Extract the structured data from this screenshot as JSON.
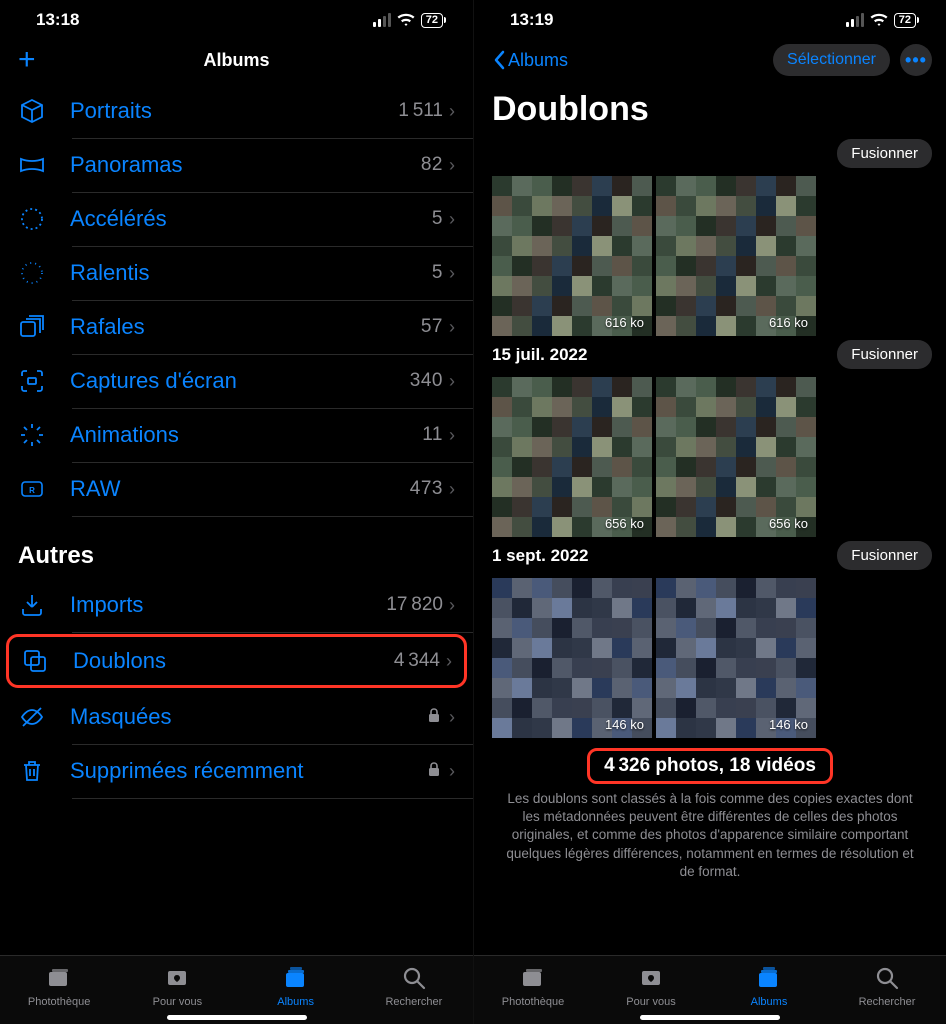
{
  "colors": {
    "accent": "#0a84ff",
    "highlight": "#ff3526",
    "secondary": "#8e8e93"
  },
  "left": {
    "status": {
      "time": "13:18",
      "battery": "72"
    },
    "nav": {
      "title": "Albums"
    },
    "rows": [
      {
        "icon": "cube",
        "label": "Portraits",
        "count": "1 511"
      },
      {
        "icon": "panorama",
        "label": "Panoramas",
        "count": "82"
      },
      {
        "icon": "timelapse",
        "label": "Accélérés",
        "count": "5"
      },
      {
        "icon": "slowmo",
        "label": "Ralentis",
        "count": "5"
      },
      {
        "icon": "burst",
        "label": "Rafales",
        "count": "57"
      },
      {
        "icon": "screenshot",
        "label": "Captures d'écran",
        "count": "340"
      },
      {
        "icon": "animations",
        "label": "Animations",
        "count": "11"
      },
      {
        "icon": "raw",
        "label": "RAW",
        "count": "473"
      }
    ],
    "section_header": "Autres",
    "other_rows": [
      {
        "icon": "import",
        "label": "Imports",
        "count": "17 820"
      },
      {
        "icon": "duplicate",
        "label": "Doublons",
        "count": "4 344",
        "highlight": true
      },
      {
        "icon": "hidden",
        "label": "Masquées",
        "locked": true
      },
      {
        "icon": "trash",
        "label": "Supprimées récemment",
        "locked": true
      }
    ]
  },
  "right": {
    "status": {
      "time": "13:19",
      "battery": "72"
    },
    "back_label": "Albums",
    "select_label": "Sélectionner",
    "page_title": "Doublons",
    "merge_label": "Fusionner",
    "groups": [
      {
        "date": "",
        "sizes": [
          "616 ko",
          "616 ko"
        ],
        "palette": "a"
      },
      {
        "date": "15 juil. 2022",
        "sizes": [
          "656 ko",
          "656 ko"
        ],
        "palette": "a"
      },
      {
        "date": "1 sept. 2022",
        "sizes": [
          "146 ko",
          "146 ko"
        ],
        "palette": "b"
      }
    ],
    "summary_count": "4 326 photos, 18 vidéos",
    "summary_text": "Les doublons sont classés à la fois comme des copies exactes dont les métadonnées peuvent être différentes de celles des photos originales, et comme des photos d'apparence similaire comportant quelques légères différences, notamment en termes de résolution et de format."
  },
  "tabs": [
    {
      "key": "library",
      "label": "Photothèque"
    },
    {
      "key": "foryou",
      "label": "Pour vous"
    },
    {
      "key": "albums",
      "label": "Albums"
    },
    {
      "key": "search",
      "label": "Rechercher"
    }
  ]
}
